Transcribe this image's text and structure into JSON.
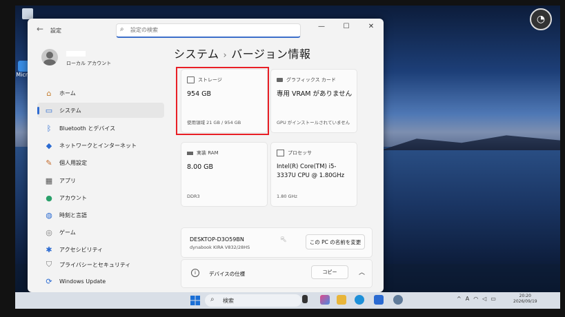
{
  "window": {
    "app_title": "設定",
    "search_placeholder": "設定の検索",
    "controls": {
      "minimize": "—",
      "maximize": "☐",
      "close": "✕"
    }
  },
  "user": {
    "account_type": "ローカル アカウント"
  },
  "sidebar": {
    "items": [
      {
        "label": "ホーム",
        "icon": "home-icon",
        "active": false
      },
      {
        "label": "システム",
        "icon": "system-icon",
        "active": true
      },
      {
        "label": "Bluetooth とデバイス",
        "icon": "bluetooth-icon",
        "active": false
      },
      {
        "label": "ネットワークとインターネット",
        "icon": "wifi-icon",
        "active": false
      },
      {
        "label": "個人用設定",
        "icon": "brush-icon",
        "active": false
      },
      {
        "label": "アプリ",
        "icon": "apps-icon",
        "active": false
      },
      {
        "label": "アカウント",
        "icon": "account-icon",
        "active": false
      },
      {
        "label": "時刻と言語",
        "icon": "globe-clock-icon",
        "active": false
      },
      {
        "label": "ゲーム",
        "icon": "game-controller-icon",
        "active": false
      },
      {
        "label": "アクセシビリティ",
        "icon": "accessibility-icon",
        "active": false
      },
      {
        "label": "プライバシーとセキュリティ",
        "icon": "shield-icon",
        "active": false
      },
      {
        "label": "Windows Update",
        "icon": "update-icon",
        "active": false
      }
    ]
  },
  "main": {
    "breadcrumb": {
      "parent": "システム",
      "separator": "›",
      "current": "バージョン情報"
    },
    "cards": {
      "storage": {
        "title": "ストレージ",
        "value": "954 GB",
        "footer": "使用領域 21 GB / 954 GB"
      },
      "graphics": {
        "title": "グラフィックス カード",
        "value": "専用 VRAM がありません",
        "footer": "GPU がインストールされていません"
      },
      "ram": {
        "title": "実装 RAM",
        "value": "8.00 GB",
        "footer": "DDR3"
      },
      "processor": {
        "title": "プロセッサ",
        "value": "Intel(R) Core(TM) i5-3337U CPU @ 1.80GHz",
        "footer": "1.80 GHz"
      }
    },
    "device": {
      "name": "DESKTOP-D3O59BN",
      "model": "dynabook KIRA V832/28HS",
      "rename_button": "この PC の名前を変更"
    },
    "specs": {
      "label": "デバイスの仕様",
      "copy_button": "コピー"
    }
  },
  "taskbar": {
    "search_label": "検索",
    "date": "2026/09/19",
    "time": "20:20"
  },
  "desktop": {
    "icon_label": "Micro"
  },
  "colors": {
    "accent": "#2f6bd1",
    "highlight": "#e81e25"
  }
}
